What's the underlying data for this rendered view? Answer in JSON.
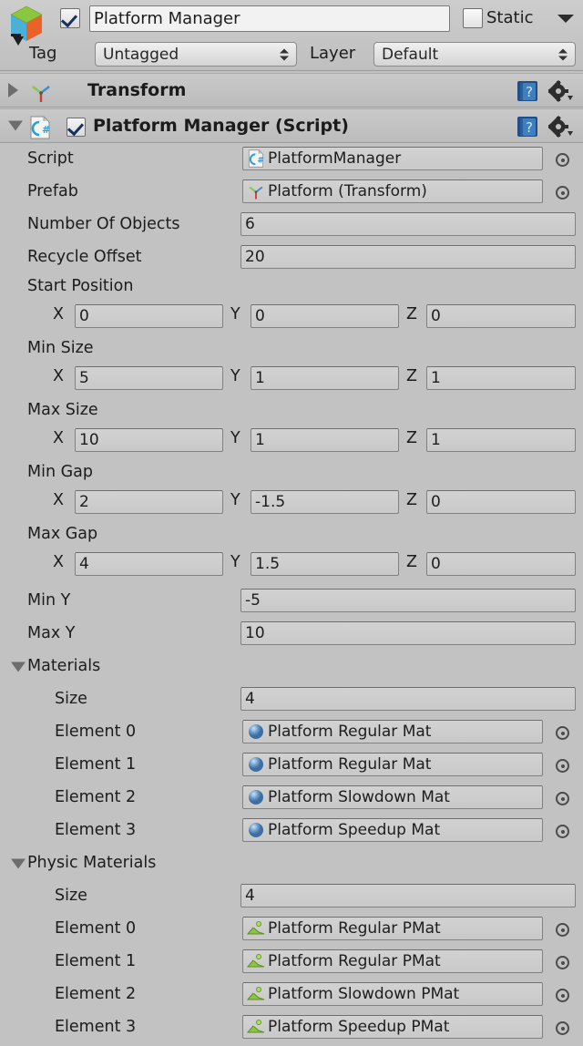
{
  "header": {
    "object_icon": "gameobject-cube-icon",
    "active_checked": true,
    "name": "Platform Manager",
    "static_label": "Static",
    "static_checked": false,
    "tag_label": "Tag",
    "tag_value": "Untagged",
    "layer_label": "Layer",
    "layer_value": "Default"
  },
  "components": [
    {
      "title": "Transform",
      "expanded": false,
      "icon": "transform-axis-icon",
      "has_enable_checkbox": false,
      "help_icon": "help-book-icon",
      "settings_icon": "gear-icon"
    },
    {
      "title": "Platform Manager (Script)",
      "expanded": true,
      "icon": "csharp-script-icon",
      "has_enable_checkbox": true,
      "enabled": true,
      "help_icon": "help-book-icon",
      "settings_icon": "gear-icon"
    }
  ],
  "properties": {
    "script": {
      "label": "Script",
      "value": "PlatformManager",
      "icon": "csharp-script-icon",
      "picker": "object-picker-icon"
    },
    "prefab": {
      "label": "Prefab",
      "value": "Platform (Transform)",
      "icon": "transform-axis-icon",
      "picker": "object-picker-icon"
    },
    "number_of_objects": {
      "label": "Number Of Objects",
      "value": "6"
    },
    "recycle_offset": {
      "label": "Recycle Offset",
      "value": "20"
    },
    "min_y": {
      "label": "Min Y",
      "value": "-5"
    },
    "max_y": {
      "label": "Max Y",
      "value": "10"
    }
  },
  "vectors": [
    {
      "label": "Start Position",
      "x": "0",
      "y": "0",
      "z": "0"
    },
    {
      "label": "Min Size",
      "x": "5",
      "y": "1",
      "z": "1"
    },
    {
      "label": "Max Size",
      "x": "10",
      "y": "1",
      "z": "1"
    },
    {
      "label": "Min Gap",
      "x": "2",
      "y": "-1.5",
      "z": "0"
    },
    {
      "label": "Max Gap",
      "x": "4",
      "y": "1.5",
      "z": "0"
    }
  ],
  "axis_labels": {
    "x": "X",
    "y": "Y",
    "z": "Z"
  },
  "materials": {
    "label": "Materials",
    "expanded": true,
    "size_label": "Size",
    "size_value": "4",
    "element_icon": "material-sphere-icon",
    "elements": [
      {
        "label": "Element 0",
        "value": "Platform Regular Mat"
      },
      {
        "label": "Element 1",
        "value": "Platform Regular Mat"
      },
      {
        "label": "Element 2",
        "value": "Platform Slowdown Mat"
      },
      {
        "label": "Element 3",
        "value": "Platform Speedup Mat"
      }
    ]
  },
  "physic_materials": {
    "label": "Physic Materials",
    "expanded": true,
    "size_label": "Size",
    "size_value": "4",
    "element_icon": "physic-material-icon",
    "elements": [
      {
        "label": "Element 0",
        "value": "Platform Regular PMat"
      },
      {
        "label": "Element 1",
        "value": "Platform Regular PMat"
      },
      {
        "label": "Element 2",
        "value": "Platform Slowdown PMat"
      },
      {
        "label": "Element 3",
        "value": "Platform Speedup PMat"
      }
    ]
  },
  "colors": {
    "background": "#c2c2c2",
    "field_bg": "#d0d0d0",
    "text": "#1c1c1c",
    "material_icon": "#5b8fc9",
    "physic_icon": "#7db342"
  }
}
